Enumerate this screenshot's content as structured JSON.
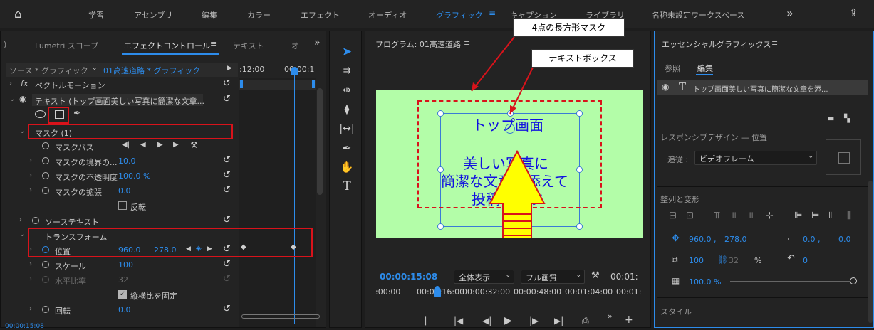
{
  "topbar": {
    "workspaces": [
      "学習",
      "アセンブリ",
      "編集",
      "カラー",
      "エフェクト",
      "オーディオ",
      "グラフィック",
      "キャプション",
      "ライブラリ",
      "名称未設定ワークスペース"
    ],
    "active_index": 6,
    "more": "»"
  },
  "left_panel": {
    "tabs": [
      "Lumetri スコープ",
      "エフェクトコントロール",
      "テキスト",
      "オ"
    ],
    "active_tab": 1,
    "source_label": "ソース * グラフィック",
    "clip_label": "01高速道路 * グラフィック",
    "time_start": ":12:00",
    "time_mid": "00:00:1",
    "rows": {
      "vector_motion": "ベクトルモーション",
      "text_layer": "テキスト (トップ画面美しい写真に簡潔な文章...",
      "mask": "マスク (1)",
      "mask_path": "マスクパス",
      "mask_feather": "マスクの境界の...",
      "mask_feather_val": "10.0",
      "mask_opacity": "マスクの不透明度",
      "mask_opacity_val": "100.0 %",
      "mask_expand": "マスクの拡張",
      "mask_expand_val": "0.0",
      "invert": "反転",
      "source_text": "ソーステキスト",
      "transform": "トランスフォーム",
      "position": "位置",
      "pos_x": "960.0",
      "pos_y": "278.0",
      "scale": "スケール",
      "scale_val": "100",
      "h_ratio": "水平比率",
      "h_ratio_val": "32",
      "uniform": "縦横比を固定",
      "rotation": "回転",
      "rotation_val": "0.0",
      "footer_time": "00:00:15:08"
    }
  },
  "program": {
    "title": "プログラム: 01高速道路",
    "timecode": "00:00:15:08",
    "fit": "全体表示",
    "quality": "フル画質",
    "end_time": "00:01:",
    "ruler": [
      ":00:00",
      "00:00:16:00",
      "00:00:32:00",
      "00:00:48:00",
      "00:01:04:00",
      "00:01:"
    ],
    "canvas_text": {
      "line1": "トップ画面",
      "line2": "美しい写真に",
      "line3": "簡潔な文章を添えて",
      "line4": "投稿します"
    }
  },
  "callouts": {
    "mask": "4点の長方形マスク",
    "textbox": "テキストボックス"
  },
  "essential": {
    "title": "エッセンシャルグラフィックス",
    "tabs": [
      "参照",
      "編集"
    ],
    "layer": "トップ画面美しい写真に簡潔な文章を添...",
    "responsive": "レスポンシブデザイン ― 位置",
    "follow_label": "追従 :",
    "follow_value": "ビデオフレーム",
    "align": "整列と変形",
    "pos_x": "960.0 ,",
    "pos_y": "278.0",
    "anchor_x": "0.0 ,",
    "anchor_y": "0.0",
    "scale": "100",
    "scale2": "32",
    "percent": "%",
    "rot": "0",
    "opacity": "100.0 %",
    "style": "スタイル"
  },
  "colors": {
    "accent": "#2d8ceb",
    "highlight": "#d9131b",
    "canvas": "#b3fda8",
    "text_blue": "#1010e0",
    "arrow": "#ffff00"
  }
}
